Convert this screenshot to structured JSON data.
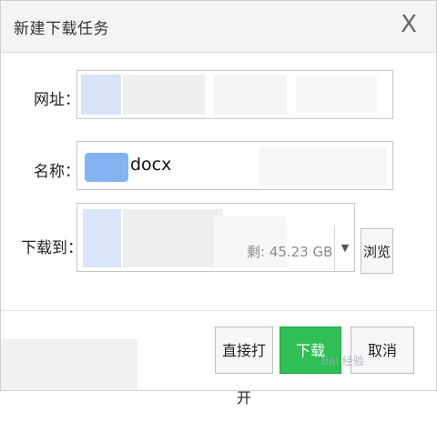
{
  "dialog": {
    "title": "新建下载任务",
    "close_glyph": "X"
  },
  "form": {
    "url_label": "网址：",
    "url_value": "",
    "name_label": "名称：",
    "name_value": "docx",
    "saveto_label": "下载到：",
    "free_space_text": "剩: 45.23 GB",
    "dropdown_glyph": "▼",
    "browse_label": "浏览"
  },
  "footer": {
    "open_label": "直接打开",
    "download_label": "下载",
    "cancel_label": "取消"
  },
  "watermark_text": "Bai 经验"
}
